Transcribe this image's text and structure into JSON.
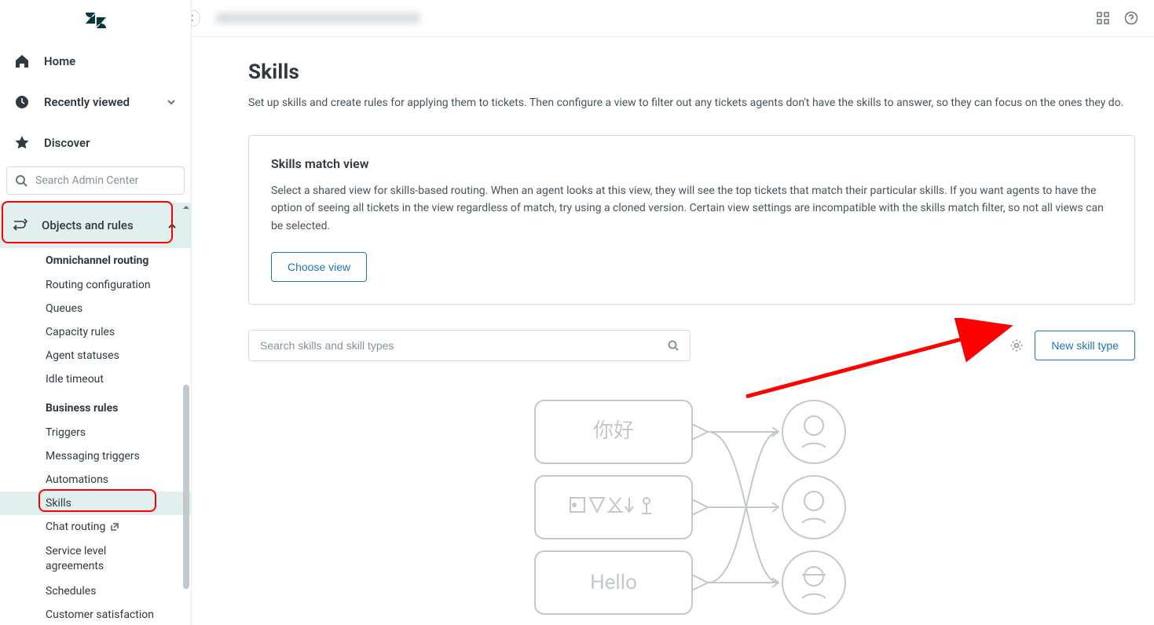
{
  "nav": {
    "home": "Home",
    "recent": "Recently viewed",
    "discover": "Discover"
  },
  "search_placeholder": "Search Admin Center",
  "section": {
    "label": "Objects and rules"
  },
  "groups": {
    "omni": {
      "title": "Omnichannel routing",
      "items": [
        "Routing configuration",
        "Queues",
        "Capacity rules",
        "Agent statuses",
        "Idle timeout"
      ]
    },
    "biz": {
      "title": "Business rules",
      "items": [
        "Triggers",
        "Messaging triggers",
        "Automations",
        "Skills",
        "Chat routing",
        "Service level agreements",
        "Schedules",
        "Customer satisfaction"
      ]
    }
  },
  "page": {
    "title": "Skills",
    "sub": "Set up skills and create rules for applying them to tickets. Then configure a view to filter out any tickets agents don't have the skills to answer, so they can focus on the ones they do."
  },
  "card": {
    "title": "Skills match view",
    "body": "Select a shared view for skills-based routing. When an agent looks at this view, they will see the top tickets that match their particular skills. If you want agents to have the option of seeing all tickets in the view regardless of match, try using a cloned version. Certain view settings are incompatible with the skills match filter, so not all views can be selected.",
    "button": "Choose view"
  },
  "toolbar": {
    "search_placeholder": "Search skills and skill types",
    "new_button": "New skill type"
  },
  "illus": {
    "b1": "你好",
    "b3": "Hello"
  }
}
